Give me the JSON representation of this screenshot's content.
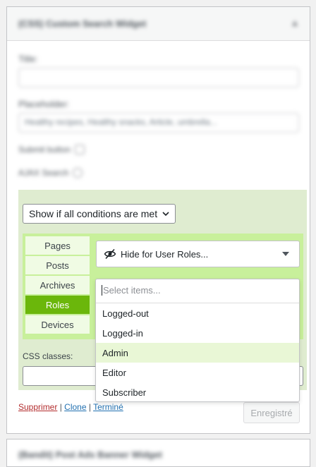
{
  "widget": {
    "title": "(CSS) Custom Search Widget",
    "title_label": "Title:",
    "title_value": "",
    "placeholder_label": "Placeholder:",
    "placeholder_value": "Healthy recipes, Healthy snacks, Article, umbrella...",
    "submit_label": "Submit button",
    "ajax_label": "AJAX Search"
  },
  "visibility": {
    "condition_select": "Show if all conditions are met",
    "tabs": [
      "Pages",
      "Posts",
      "Archives",
      "Roles",
      "Devices"
    ],
    "active_tab": "Roles",
    "rule_select": "Hide for User Roles...",
    "css_label": "CSS classes:",
    "css_value": ""
  },
  "dropdown": {
    "search_placeholder": "Select items...",
    "options": [
      "Logged-out",
      "Logged-in",
      "Admin",
      "Editor",
      "Subscriber"
    ],
    "highlighted": "Admin"
  },
  "actions": {
    "delete": "Supprimer",
    "clone": "Clone",
    "done": "Terminé",
    "separator": " | ",
    "save": "Enregistré"
  },
  "next_widget": {
    "title": "(Bandit) Post Ads Banner Widget"
  },
  "icons": {
    "eye": "eye-slash-icon",
    "caret": "caret-down-icon",
    "chevron": "chevron-down-icon"
  },
  "colors": {
    "visibility_bg": "#dfecd0",
    "rules_bg": "#c8f09b",
    "tab_active": "#6bb70b",
    "highlight": "#e9f7d6",
    "delete_link": "#b32d2e",
    "link": "#2271b1"
  }
}
